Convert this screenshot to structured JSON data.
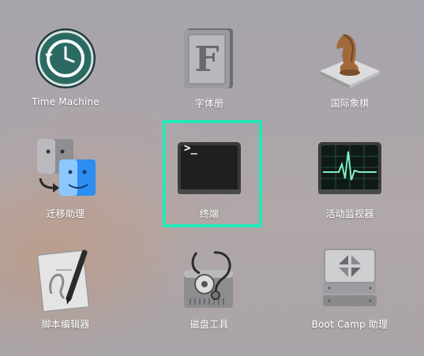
{
  "launchpad": {
    "apps": [
      {
        "label": "Time Machine",
        "icon": "time-machine-icon"
      },
      {
        "label": "字体册",
        "icon": "font-book-icon"
      },
      {
        "label": "国际象棋",
        "icon": "chess-icon"
      },
      {
        "label": "迁移助理",
        "icon": "migration-assistant-icon"
      },
      {
        "label": "终端",
        "icon": "terminal-icon"
      },
      {
        "label": "活动监视器",
        "icon": "activity-monitor-icon"
      },
      {
        "label": "脚本编辑器",
        "icon": "script-editor-icon"
      },
      {
        "label": "磁盘工具",
        "icon": "disk-utility-icon"
      },
      {
        "label": "Boot Camp 助理",
        "icon": "boot-camp-icon"
      }
    ],
    "terminal_prompt": ">_",
    "highlight_color": "#23e8b6"
  }
}
